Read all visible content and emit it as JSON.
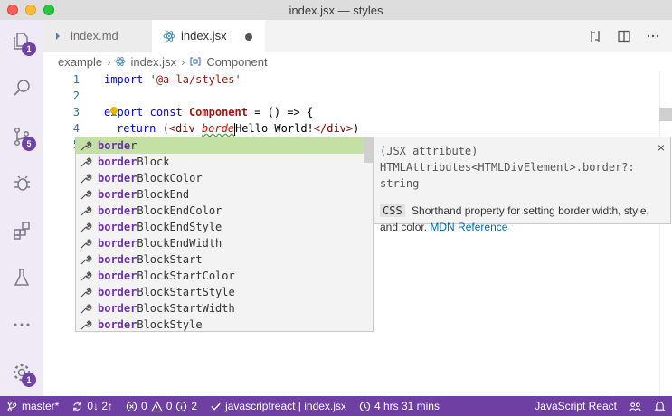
{
  "window": {
    "title": "index.jsx — styles"
  },
  "activity_bar": {
    "explorer_badge": "1",
    "scm_badge": "5",
    "settings_badge": "1"
  },
  "tabs": [
    {
      "label": "index.md"
    },
    {
      "label": "index.jsx"
    }
  ],
  "breadcrumb": {
    "folder": "example",
    "file": "index.jsx",
    "symbol": "Component"
  },
  "editor": {
    "line_numbers": [
      "1",
      "2",
      "3",
      "4",
      "5"
    ],
    "lines": {
      "l1_kw": "import",
      "l1_str": "'@a-la/styles'",
      "l3_kw1": "export",
      "l3_kw2": "const",
      "l3_name": "Component",
      "l3_rest": " = () => {",
      "l4_kw": "return",
      "l4_open": " (",
      "l4_tag_open": "<div",
      "l4_attr": "borde",
      "l4_text": "Hello World!",
      "l4_tag_close": "</div>",
      "l4_end": ")"
    }
  },
  "suggest": {
    "match_prefix": "border",
    "items": [
      {
        "match": "borde",
        "rest": "r"
      },
      {
        "match": "border",
        "rest": "Block"
      },
      {
        "match": "border",
        "rest": "BlockColor"
      },
      {
        "match": "border",
        "rest": "BlockEnd"
      },
      {
        "match": "border",
        "rest": "BlockEndColor"
      },
      {
        "match": "border",
        "rest": "BlockEndStyle"
      },
      {
        "match": "border",
        "rest": "BlockEndWidth"
      },
      {
        "match": "border",
        "rest": "BlockStart"
      },
      {
        "match": "border",
        "rest": "BlockStartColor"
      },
      {
        "match": "border",
        "rest": "BlockStartStyle"
      },
      {
        "match": "border",
        "rest": "BlockStartWidth"
      },
      {
        "match": "border",
        "rest": "BlockStyle"
      }
    ]
  },
  "details": {
    "signature": "(JSX attribute) HTMLAttributes<HTMLDivElement>.border?: string",
    "css_tag": "CSS",
    "description": "Shorthand property for setting border width, style, and color.",
    "link": "MDN Reference",
    "close": "×"
  },
  "statusbar": {
    "branch": "master*",
    "sync": "0↓ 2↑",
    "errors": "0",
    "warnings": "0",
    "infos": "2",
    "language_check": "javascriptreact | index.jsx",
    "time": "4 hrs 31 mins",
    "language": "JavaScript React"
  },
  "colors": {
    "statusbar": "#6f3fa3",
    "activity_bar": "#f0eaf7",
    "suggest_selected": "#c5e0a5",
    "match": "#6f2fb3"
  }
}
